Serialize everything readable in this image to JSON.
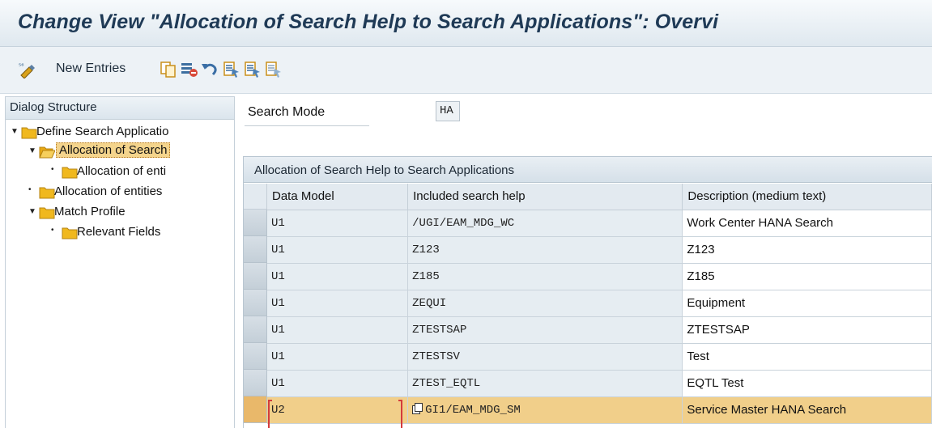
{
  "window": {
    "title": "Change View \"Allocation of Search Help to Search Applications\": Overvi"
  },
  "toolbar": {
    "new_entries_label": "New Entries",
    "icons": [
      "display-change-icon",
      "copy-icon",
      "delete-icon",
      "undo-icon",
      "select-all-icon",
      "select-block-icon",
      "deselect-all-icon"
    ]
  },
  "dialog_structure": {
    "header": "Dialog Structure",
    "nodes": [
      {
        "label": "Define Search Applicatio",
        "level": 0,
        "expanded": true,
        "selected": false
      },
      {
        "label": "Allocation of Search",
        "level": 1,
        "expanded": true,
        "selected": true
      },
      {
        "label": "Allocation of enti",
        "level": 2,
        "expanded": false,
        "selected": false
      },
      {
        "label": "Allocation of entities",
        "level": 1,
        "expanded": false,
        "selected": false
      },
      {
        "label": "Match Profile",
        "level": 1,
        "expanded": true,
        "selected": false
      },
      {
        "label": "Relevant Fields",
        "level": 2,
        "expanded": false,
        "selected": false
      }
    ]
  },
  "search_mode": {
    "label": "Search Mode",
    "value": "HA"
  },
  "table": {
    "title": "Allocation of Search Help to Search Applications",
    "columns": [
      "Data Model",
      "Included search help",
      "Description (medium text)"
    ],
    "rows": [
      {
        "data_model": "U1",
        "search_help": "/UGI/EAM_MDG_WC",
        "description": "Work Center HANA Search"
      },
      {
        "data_model": "U1",
        "search_help": "Z123",
        "description": "Z123"
      },
      {
        "data_model": "U1",
        "search_help": "Z185",
        "description": "Z185"
      },
      {
        "data_model": "U1",
        "search_help": "ZEQUI",
        "description": "Equipment"
      },
      {
        "data_model": "U1",
        "search_help": "ZTESTSAP",
        "description": "ZTESTSAP"
      },
      {
        "data_model": "U1",
        "search_help": "ZTESTSV",
        "description": "Test"
      },
      {
        "data_model": "U1",
        "search_help": "ZTEST_EQTL",
        "description": "EQTL Test"
      },
      {
        "data_model": "U2",
        "search_help": "GI1/EAM_MDG_SM",
        "description": "Service Master HANA Search"
      }
    ]
  },
  "colors": {
    "folder": "#f0b81e",
    "highlight_row": "#f1cf8a",
    "title_text": "#1f3a56"
  }
}
